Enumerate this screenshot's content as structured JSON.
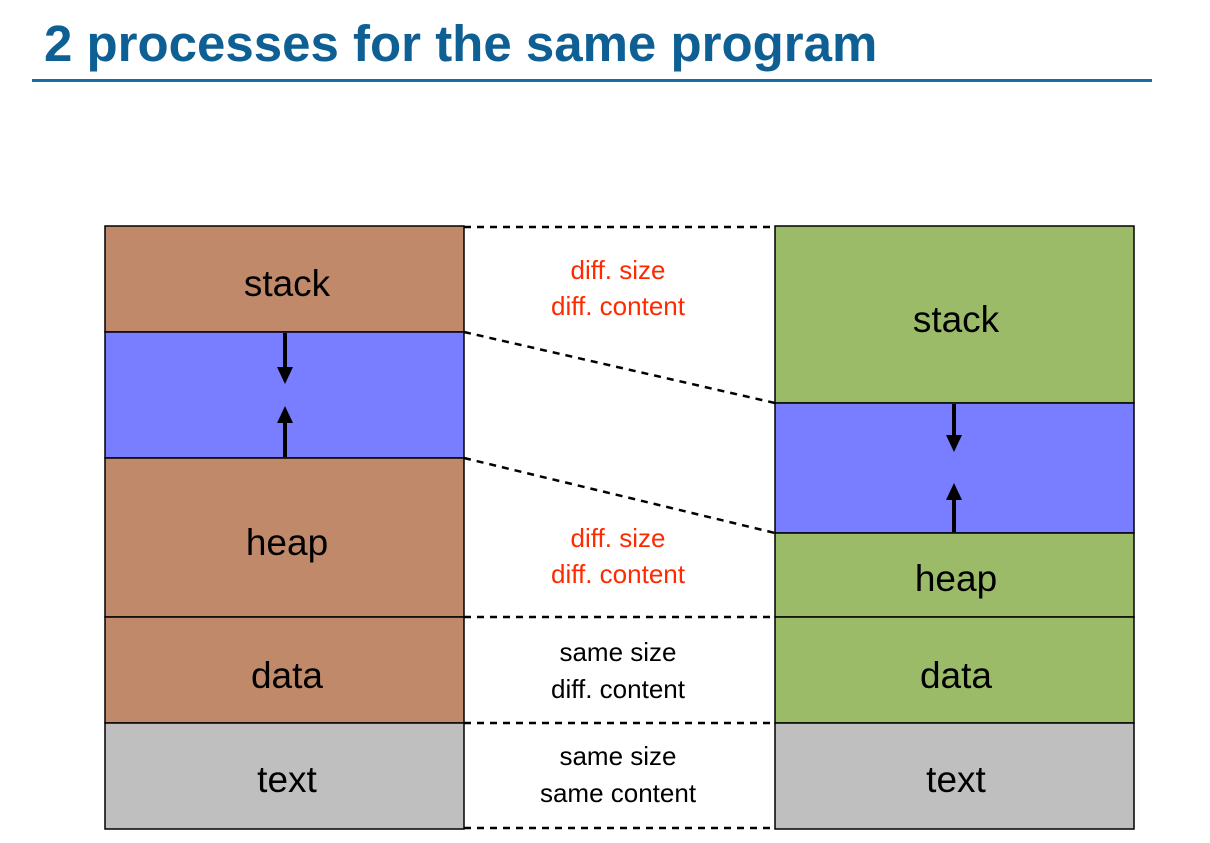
{
  "title": "2 processes for the same program",
  "left_process": {
    "stack": "stack",
    "heap": "heap",
    "data": "data",
    "text": "text"
  },
  "right_process": {
    "stack": "stack",
    "heap": "heap",
    "data": "data",
    "text": "text"
  },
  "comparisons": {
    "stack": {
      "line1": "diff. size",
      "line2": "diff. content"
    },
    "heap": {
      "line1": "diff. size",
      "line2": "diff. content"
    },
    "data": {
      "line1": "same size",
      "line2": "diff. content"
    },
    "text": {
      "line1": "same size",
      "line2": "same content"
    }
  },
  "colors": {
    "title": "#0e5f94",
    "left_segment_fill": "#c0896a",
    "right_segment_fill": "#9bbb69",
    "free_space_fill": "#797dff",
    "text_segment_fill": "#bfbfbf",
    "difference_note": "#ff2a00"
  },
  "icons": {
    "growth_arrows": [
      "arrow-down-icon",
      "arrow-up-icon"
    ]
  }
}
